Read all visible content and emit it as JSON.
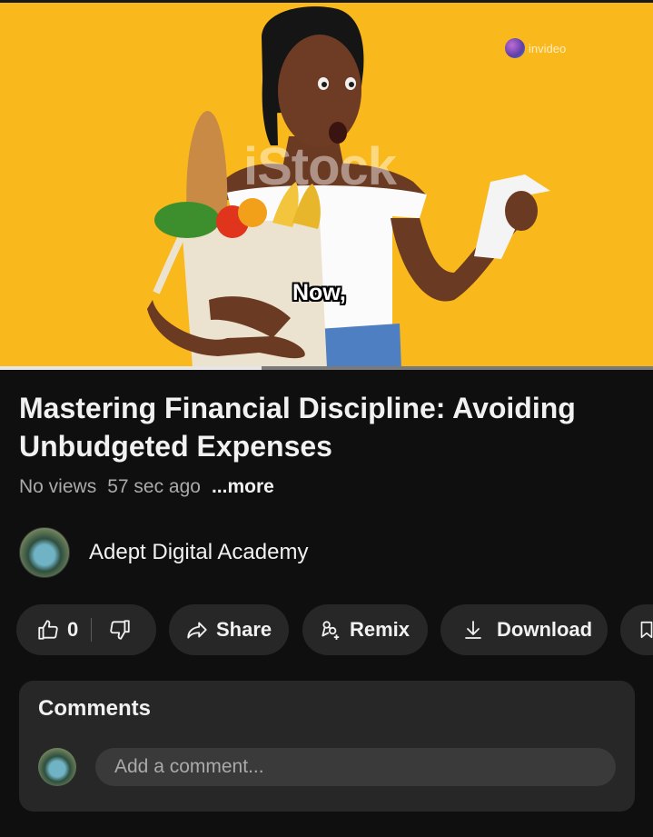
{
  "video": {
    "caption": "Now,",
    "watermark_istock": "iStock",
    "watermark_invideo": "invideo",
    "progress": 0.4
  },
  "info": {
    "title": "Mastering Financial Discipline: Avoiding Unbudgeted Expenses",
    "views": "No views",
    "age": "57 sec ago",
    "more_label": "...more"
  },
  "channel": {
    "name": "Adept Digital Academy",
    "avatar_icon": "channel-avatar"
  },
  "actions": {
    "like_count": "0",
    "like_icon": "thumbs-up-icon",
    "dislike_icon": "thumbs-down-icon",
    "share_label": "Share",
    "share_icon": "share-arrow-icon",
    "remix_label": "Remix",
    "remix_icon": "remix-icon",
    "download_label": "Download",
    "download_icon": "download-icon",
    "save_icon": "bookmark-icon"
  },
  "comments": {
    "title": "Comments",
    "placeholder": "Add a comment..."
  },
  "colors": {
    "video_background": "#f9b81b",
    "page_background": "#0f0f0f",
    "pill_background": "#272727"
  }
}
